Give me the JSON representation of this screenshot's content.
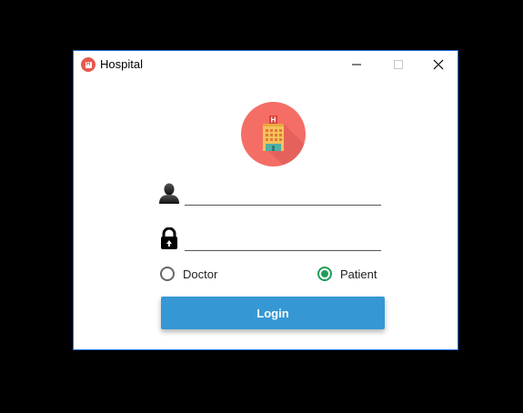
{
  "window": {
    "title": "Hospital",
    "app_icon": "hospital-app-icon",
    "controls": {
      "minimize_icon": "minimize-icon",
      "maximize_icon": "maximize-icon",
      "close_icon": "close-icon"
    }
  },
  "login_form": {
    "logo_icon": "hospital-building-icon",
    "username": {
      "icon": "user-icon",
      "value": ""
    },
    "password": {
      "icon": "lock-icon",
      "value": ""
    },
    "role_options": [
      {
        "label": "Doctor",
        "selected": false
      },
      {
        "label": "Patient",
        "selected": true
      }
    ],
    "login_label": "Login"
  },
  "colors": {
    "accent": "#3598d4",
    "radio_selected": "#1f9d58",
    "logo_background": "#f46e66",
    "window_border": "#1e6fd9"
  }
}
